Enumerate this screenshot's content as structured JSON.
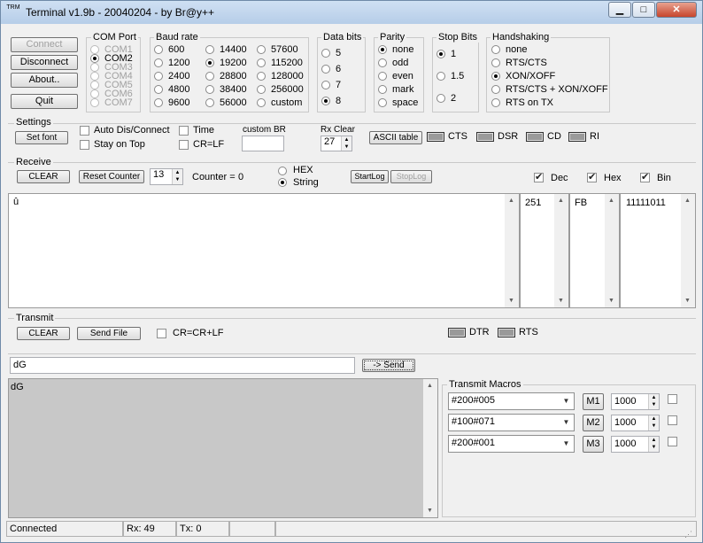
{
  "window": {
    "title": "Terminal v1.9b - 20040204 - by Br@y++",
    "icon_text": "TRM"
  },
  "conn_buttons": {
    "connect": "Connect",
    "disconnect": "Disconnect",
    "about": "About..",
    "quit": "Quit"
  },
  "com_port": {
    "title": "COM Port",
    "options": [
      "COM1",
      "COM2",
      "COM3",
      "COM4",
      "COM5",
      "COM6",
      "COM7"
    ],
    "selected": "COM2"
  },
  "baud": {
    "title": "Baud rate",
    "col1": [
      "600",
      "1200",
      "2400",
      "4800",
      "9600"
    ],
    "col2": [
      "14400",
      "19200",
      "28800",
      "38400",
      "56000"
    ],
    "col3": [
      "57600",
      "115200",
      "128000",
      "256000",
      "custom"
    ],
    "selected": "19200"
  },
  "data_bits": {
    "title": "Data bits",
    "options": [
      "5",
      "6",
      "7",
      "8"
    ],
    "selected": "8"
  },
  "parity": {
    "title": "Parity",
    "options": [
      "none",
      "odd",
      "even",
      "mark",
      "space"
    ],
    "selected": "none"
  },
  "stop_bits": {
    "title": "Stop Bits",
    "options": [
      "1",
      "1.5",
      "2"
    ],
    "selected": "1"
  },
  "handshaking": {
    "title": "Handshaking",
    "options": [
      "none",
      "RTS/CTS",
      "XON/XOFF",
      "RTS/CTS + XON/XOFF",
      "RTS on TX"
    ],
    "selected": "XON/XOFF"
  },
  "settings": {
    "title": "Settings",
    "set_font": "Set font",
    "auto_dis": "Auto Dis/Connect",
    "stay_on_top": "Stay on Top",
    "time": "Time",
    "crlf": "CR=LF",
    "custom_br_label": "custom BR",
    "custom_br_value": "",
    "rx_clear_label": "Rx Clear",
    "rx_clear_value": "27",
    "ascii_table": "ASCII table",
    "leds": [
      "CTS",
      "DSR",
      "CD",
      "RI"
    ]
  },
  "receive": {
    "title": "Receive",
    "clear": "CLEAR",
    "reset_counter": "Reset Counter",
    "counter_spin": "13",
    "counter_label": "Counter =",
    "counter_value": "0",
    "mode_hex": "HEX",
    "mode_string": "String",
    "mode_selected": "String",
    "start_log": "StartLog",
    "stop_log": "StopLog",
    "show_dec": "Dec",
    "show_hex": "Hex",
    "show_bin": "Bin",
    "text": "û",
    "dec_value": "251",
    "hex_value": "FB",
    "bin_value": "11111011"
  },
  "transmit": {
    "title": "Transmit",
    "clear": "CLEAR",
    "send_file": "Send File",
    "cr_option": "CR=CR+LF",
    "leds": [
      "DTR",
      "RTS"
    ],
    "input_value": "dG",
    "send_button": "-> Send",
    "history_text": "dG"
  },
  "macros": {
    "title": "Transmit Macros",
    "rows": [
      {
        "value": "#200#005",
        "button": "M1",
        "interval": "1000"
      },
      {
        "value": "#100#071",
        "button": "M2",
        "interval": "1000"
      },
      {
        "value": "#200#001",
        "button": "M3",
        "interval": "1000"
      }
    ]
  },
  "status_bar": {
    "state": "Connected",
    "rx": "Rx: 49",
    "tx": "Tx: 0"
  }
}
